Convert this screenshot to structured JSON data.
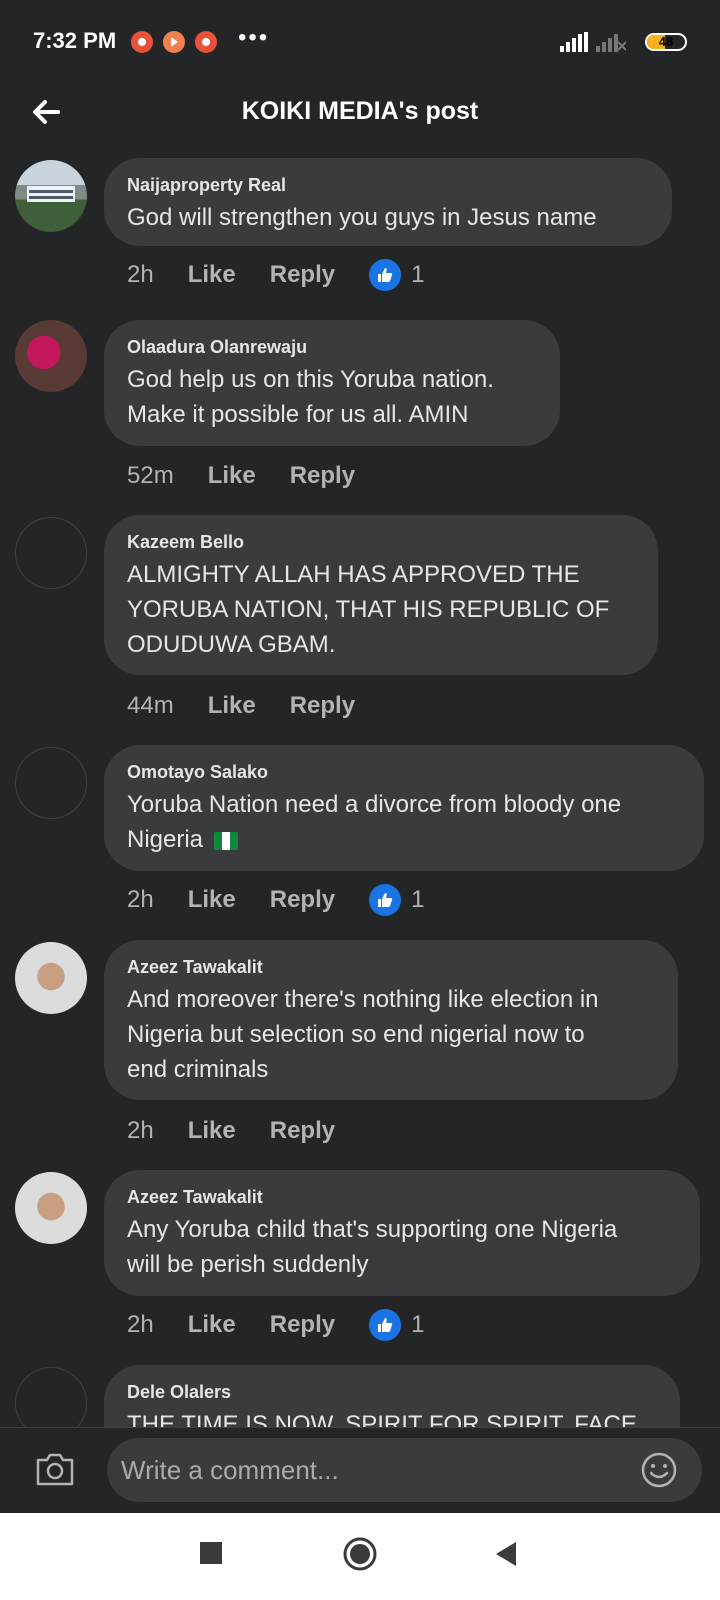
{
  "status_bar": {
    "time": "7:32 PM",
    "more": "•••",
    "battery": "48",
    "battery_level_pct": 48
  },
  "header": {
    "title": "KOIKI MEDIA's post",
    "back_icon": "arrow-left-icon"
  },
  "comments": [
    {
      "author": "Naijaproperty Real",
      "text": "God will strengthen you guys in Jesus name",
      "time": "2h",
      "like": "Like",
      "reply": "Reply",
      "reactions": "1"
    },
    {
      "author": "Olaadura Olanrewaju",
      "text": "God help us on this Yoruba nation.\nMake it possible for us all. AMIN",
      "time": "52m",
      "like": "Like",
      "reply": "Reply"
    },
    {
      "author": "Kazeem Bello",
      "text": "ALMIGHTY ALLAH HAS APPROVED THE\nYORUBA NATION, THAT HIS REPUBLIC OF\nODUDUWA  GBAM.",
      "time": "44m",
      "like": "Like",
      "reply": "Reply"
    },
    {
      "author": "Omotayo Salako",
      "text": "Yoruba Nation need a divorce from bloody one\nNigeria",
      "time": "2h",
      "like": "Like",
      "reply": "Reply",
      "reactions": "1"
    },
    {
      "author": "Azeez Tawakalit",
      "text": "And moreover there's nothing like election in\nNigeria but selection so end nigerial now to\nend criminals",
      "time": "2h",
      "like": "Like",
      "reply": "Reply"
    },
    {
      "author": "Azeez Tawakalit",
      "text": "Any Yoruba child that's supporting one Nigeria\nwill be perish suddenly",
      "time": "2h",
      "like": "Like",
      "reply": "Reply",
      "reactions": "1"
    },
    {
      "author": "Dele Olalers",
      "text": "THE TIME IS NOW, SPIRIT FOR SPIRIT, FACE"
    }
  ],
  "composer": {
    "placeholder": "Write a comment...",
    "camera_icon": "camera-icon",
    "emoji_icon": "emoji-icon"
  },
  "navbar": {
    "recents_icon": "square-icon",
    "home_icon": "circle-icon",
    "back_icon": "triangle-back-icon"
  },
  "colors": {
    "background": "#242526",
    "bubble": "#3a3b3c",
    "text": "#e4e6eb",
    "muted": "#b0b3b8",
    "reaction_blue": "#1b74e4",
    "battery": "#f7b21c"
  }
}
